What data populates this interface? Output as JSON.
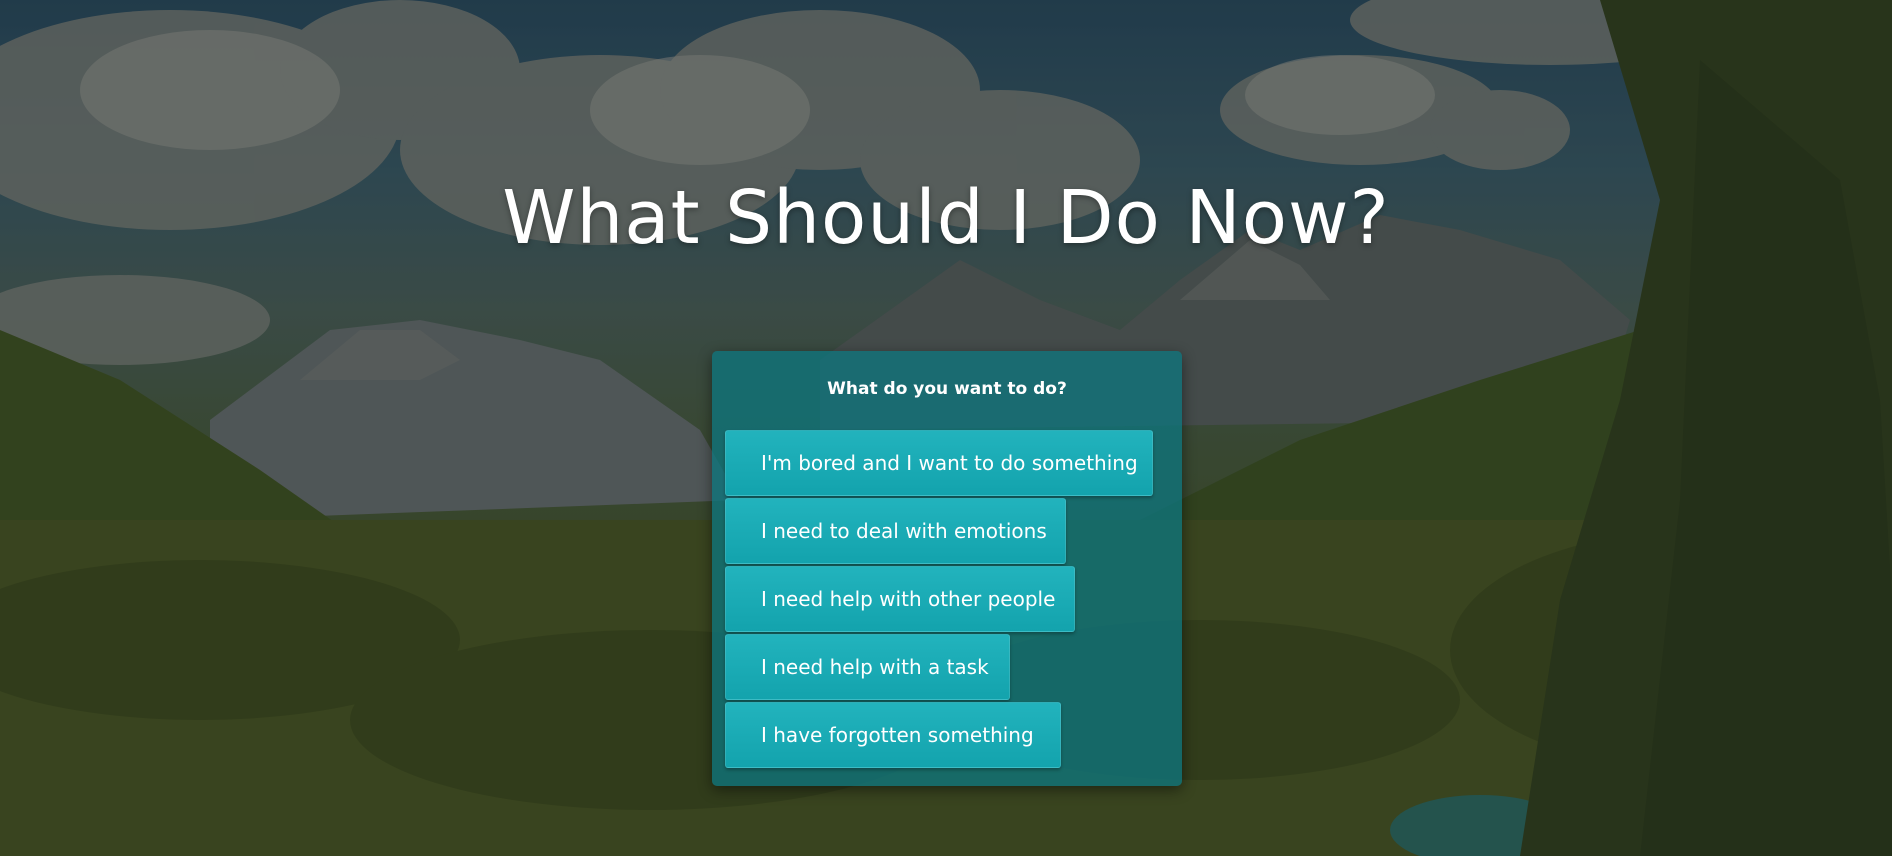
{
  "page": {
    "title": "What Should I Do Now?"
  },
  "panel": {
    "heading": "What do you want to do?",
    "options": [
      {
        "label": "I'm bored and I want to do something"
      },
      {
        "label": "I need to deal with emotions"
      },
      {
        "label": "I need help with other people"
      },
      {
        "label": "I need help with a task"
      },
      {
        "label": "I have forgotten something"
      }
    ]
  },
  "colors": {
    "panel": "#0e747c",
    "button": "#17a9b3",
    "text": "#ffffff"
  }
}
